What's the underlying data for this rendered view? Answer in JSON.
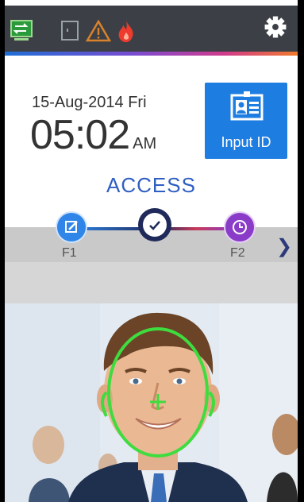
{
  "status": {
    "icons": [
      "network-icon",
      "device-icon",
      "warning-icon",
      "fire-alarm-icon"
    ],
    "settings_icon": "gear-icon"
  },
  "clock": {
    "date": "15-Aug-2014 Fri",
    "time": "05:02",
    "ampm": "AM"
  },
  "input_id": {
    "label": "Input ID",
    "icon": "id-card-icon"
  },
  "mode": {
    "title": "ACCESS"
  },
  "function_keys": [
    {
      "label": "F1",
      "icon": "edit-icon",
      "color": "#2f86e8"
    },
    {
      "label": "",
      "icon": "check-icon",
      "color": "#1f2a5a"
    },
    {
      "label": "F2",
      "icon": "clock-icon",
      "color": "#8a3cc8"
    }
  ],
  "next_icon": "chevron-right-icon",
  "colors": {
    "statusbar": "#3c4046",
    "accent_blue": "#1e7de0",
    "access_text": "#2f5fc2",
    "face_guide": "#3fdc3f"
  }
}
